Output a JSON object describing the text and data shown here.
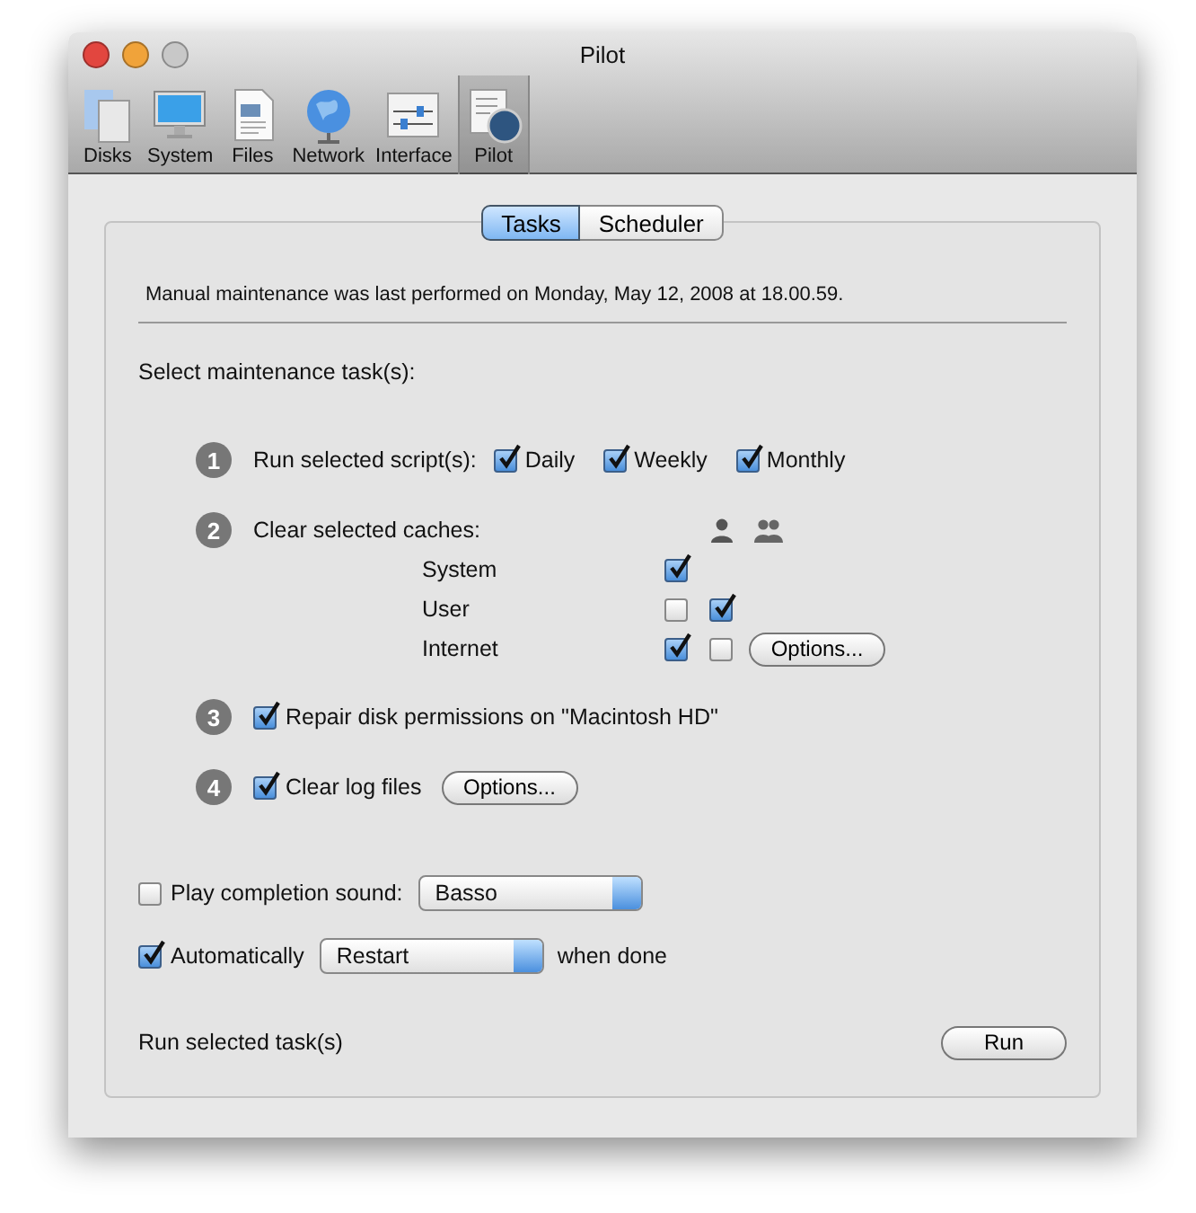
{
  "window": {
    "title": "Pilot"
  },
  "toolbar": [
    {
      "label": "Disks",
      "kind": "disks",
      "selected": false
    },
    {
      "label": "System",
      "kind": "system",
      "selected": false
    },
    {
      "label": "Files",
      "kind": "files",
      "selected": false
    },
    {
      "label": "Network",
      "kind": "network",
      "selected": false
    },
    {
      "label": "Interface",
      "kind": "interface",
      "selected": false
    },
    {
      "label": "Pilot",
      "kind": "pilot",
      "selected": true
    }
  ],
  "tabs": [
    {
      "label": "Tasks",
      "selected": true
    },
    {
      "label": "Scheduler",
      "selected": false
    }
  ],
  "last_run": "Manual maintenance was last performed on Monday, May 12, 2008 at 18.00.59.",
  "heading": "Select maintenance task(s):",
  "steps": [
    {
      "number": "1",
      "kind": "scripts",
      "label": "Run selected script(s):",
      "options": [
        {
          "label": "Daily",
          "checked": true
        },
        {
          "label": "Weekly",
          "checked": true
        },
        {
          "label": "Monthly",
          "checked": true
        }
      ]
    },
    {
      "number": "2",
      "kind": "caches",
      "label": "Clear selected caches:",
      "rows": [
        {
          "label": "System",
          "checks": [
            {
              "checked": true
            }
          ]
        },
        {
          "label": "User",
          "checks": [
            {
              "checked": false
            },
            {
              "checked": true
            }
          ]
        },
        {
          "label": "Internet",
          "checks": [
            {
              "checked": true
            },
            {
              "checked": false
            }
          ],
          "button": "Options..."
        }
      ]
    },
    {
      "number": "3",
      "kind": "check",
      "label": "Repair disk permissions on \"Macintosh HD\"",
      "checked": true
    },
    {
      "number": "4",
      "kind": "check",
      "label": "Clear log files",
      "checked": true,
      "button": "Options..."
    }
  ],
  "sound": {
    "label": "Play completion sound:",
    "checked": false,
    "value": "Basso"
  },
  "auto": {
    "label": "Automatically",
    "checked": true,
    "value": "Restart",
    "suffix": "when done"
  },
  "footer": {
    "label": "Run selected task(s)",
    "button": "Run"
  }
}
